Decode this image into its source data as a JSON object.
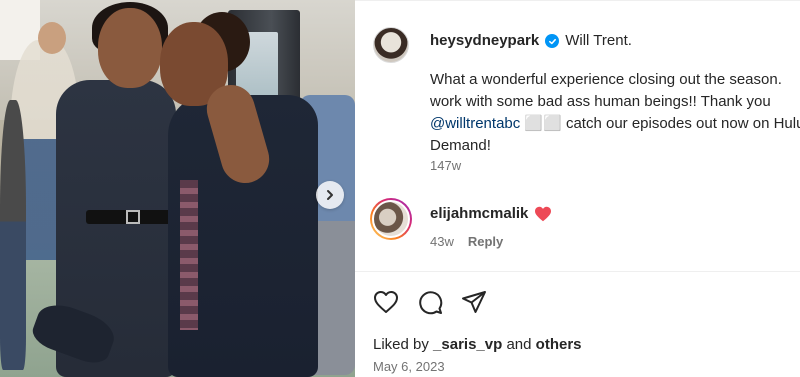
{
  "post": {
    "author": "heysydneypark",
    "caption_title": "Will Trent.",
    "caption_lines": [
      "What a wonderful experience closing out the season.",
      "work with some bad ass human beings!! Thank you"
    ],
    "mention": "@willtrentabc",
    "mention_suffix": " ⬜⬜ catch our episodes out now on Hulu",
    "caption_last": "Demand!",
    "age": "147w"
  },
  "comment": {
    "author": "elijahmcmalik",
    "age": "43w",
    "reply_label": "Reply"
  },
  "likes": {
    "prefix": "Liked by",
    "user": "_saris_vp",
    "joiner": "and",
    "others": "others"
  },
  "date": "May 6, 2023",
  "colors": {
    "verified": "#0095f6",
    "heart": "#ed4956",
    "mention": "#00376b",
    "muted": "#737373"
  }
}
